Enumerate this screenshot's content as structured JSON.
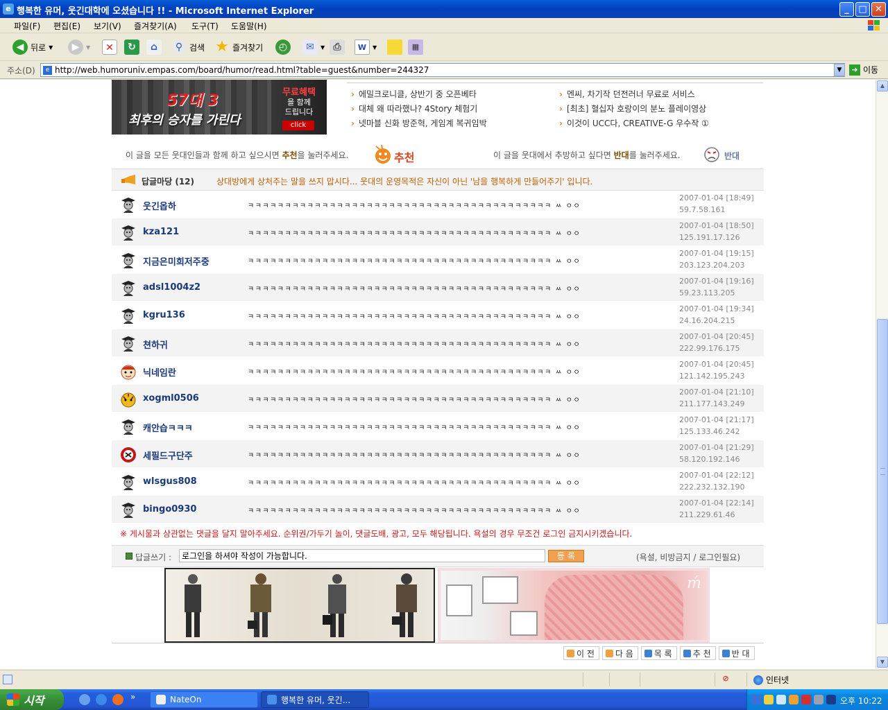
{
  "window": {
    "title": "행복한 유머, 웃긴대학에 오셨습니다 !! - Microsoft Internet Explorer",
    "controls": {
      "minimize": "_",
      "maximize": "□",
      "close": "✕"
    }
  },
  "menu": [
    "파일(F)",
    "편집(E)",
    "보기(V)",
    "즐겨찾기(A)",
    "도구(T)",
    "도움말(H)"
  ],
  "toolbar": {
    "back": "뒤로",
    "search": "검색",
    "favorites": "즐겨찾기"
  },
  "address": {
    "label": "주소(D)",
    "url": "http://web.humoruniv.empas.com/board/humor/read.html?table=guest&number=244327",
    "go": "이동"
  },
  "banner": {
    "big": "57대 3",
    "sub": "최후의 승자를 가린다",
    "free_top": "무료혜택",
    "free_mid": "을 함께",
    "free_bot": "드립니다",
    "click": "click"
  },
  "news": {
    "left": [
      "에밀크로니클, 상반기 중 오픈베타",
      "대체 왜 따라했나? 4Story 체험기",
      "넷마블 신화 방준혁, 게임계 복귀임박"
    ],
    "right": [
      "엔씨, 차기작 던전러너 무료로 서비스",
      "[최초] 혈십자 호랑이의 분노 플레이영상",
      "이것이 UCC다, CREATIVE-G 우수작 ①"
    ]
  },
  "recommend": {
    "left_pre": "이 글을 모든 웃대인들과 함께 하고 싶으시면 ",
    "left_bold": "추천",
    "left_post": "을 눌러주세요.",
    "left_icon_label": "추천",
    "right_pre": "이 글을 웃대에서 추방하고 싶다면 ",
    "right_bold": "반대",
    "right_post": "를 눌러주세요.",
    "right_icon_label": "반대"
  },
  "replies": {
    "title": "답글마당 (12)",
    "notice": "상대방에게 상처주는 말을 쓰지 맙시다... 웃대의 운영목적은 자신이 아닌 '남을 행복하게 만들어주기' 입니다.",
    "items": [
      {
        "nick": "웃긴옵하",
        "msg": "ㅋㅋㅋㅋㅋㅋㅋㅋㅋㅋㅋㅋㅋㅋㅋㅋㅋㅋㅋㅋㅋㅋㅋㅋㅋㅋㅋㅋㅋㅋㅋㅋㅋㅋㅋㅋㅋㅋㅋㅋㅋ ㅆ ㅇㅇ",
        "date": "2007-01-04 [18:49]",
        "ip": "59.7.58.161",
        "avatar": "grad"
      },
      {
        "nick": "kza121",
        "msg": "ㅋㅋㅋㅋㅋㅋㅋㅋㅋㅋㅋㅋㅋㅋㅋㅋㅋㅋㅋㅋㅋㅋㅋㅋㅋㅋㅋㅋㅋㅋㅋㅋㅋㅋㅋㅋㅋㅋㅋㅋㅋ ㅆ ㅇㅇ",
        "date": "2007-01-04 [18:50]",
        "ip": "125.191.17.126",
        "avatar": "grad"
      },
      {
        "nick": "지금은미희저주중",
        "msg": "ㅋㅋㅋㅋㅋㅋㅋㅋㅋㅋㅋㅋㅋㅋㅋㅋㅋㅋㅋㅋㅋㅋㅋㅋㅋㅋㅋㅋㅋㅋㅋㅋㅋㅋㅋㅋㅋㅋㅋㅋㅋ ㅆ ㅇㅇ",
        "date": "2007-01-04 [19:15]",
        "ip": "203.123.204.203",
        "avatar": "grad"
      },
      {
        "nick": "adsl1004z2",
        "msg": "ㅋㅋㅋㅋㅋㅋㅋㅋㅋㅋㅋㅋㅋㅋㅋㅋㅋㅋㅋㅋㅋㅋㅋㅋㅋㅋㅋㅋㅋㅋㅋㅋㅋㅋㅋㅋㅋㅋㅋㅋㅋ ㅆ ㅇㅇ",
        "date": "2007-01-04 [19:16]",
        "ip": "59.23.113.205",
        "avatar": "grad"
      },
      {
        "nick": "kgru136",
        "msg": "ㅋㅋㅋㅋㅋㅋㅋㅋㅋㅋㅋㅋㅋㅋㅋㅋㅋㅋㅋㅋㅋㅋㅋㅋㅋㅋㅋㅋㅋㅋㅋㅋㅋㅋㅋㅋㅋㅋㅋㅋㅋ ㅆ ㅇㅇ",
        "date": "2007-01-04 [19:34]",
        "ip": "24.16.204.215",
        "avatar": "grad"
      },
      {
        "nick": "쳔하귀",
        "msg": "ㅋㅋㅋㅋㅋㅋㅋㅋㅋㅋㅋㅋㅋㅋㅋㅋㅋㅋㅋㅋㅋㅋㅋㅋㅋㅋㅋㅋㅋㅋㅋㅋㅋㅋㅋㅋㅋㅋㅋㅋㅋ ㅆ ㅇㅇ",
        "date": "2007-01-04 [20:45]",
        "ip": "222.99.176.175",
        "avatar": "grad"
      },
      {
        "nick": "닉네임란",
        "msg": "ㅋㅋㅋㅋㅋㅋㅋㅋㅋㅋㅋㅋㅋㅋㅋㅋㅋㅋㅋㅋㅋㅋㅋㅋㅋㅋㅋㅋㅋㅋㅋㅋㅋㅋㅋㅋㅋㅋㅋㅋㅋ ㅆ ㅇㅇ",
        "date": "2007-01-04 [20:45]",
        "ip": "121.142.195.243",
        "avatar": "face"
      },
      {
        "nick": "xogml0506",
        "msg": "ㅋㅋㅋㅋㅋㅋㅋㅋㅋㅋㅋㅋㅋㅋㅋㅋㅋㅋㅋㅋㅋㅋㅋㅋㅋㅋㅋㅋㅋㅋㅋㅋㅋㅋㅋㅋㅋㅋㅋㅋㅋ ㅆ ㅇㅇ",
        "date": "2007-01-04 [21:10]",
        "ip": "211.177.143.249",
        "avatar": "tiger"
      },
      {
        "nick": "캐안습ㅋㅋㅋ",
        "msg": "ㅋㅋㅋㅋㅋㅋㅋㅋㅋㅋㅋㅋㅋㅋㅋㅋㅋㅋㅋㅋㅋㅋㅋㅋㅋㅋㅋㅋㅋㅋㅋㅋㅋㅋㅋㅋㅋㅋㅋㅋㅋ ㅆ ㅇㅇ",
        "date": "2007-01-04 [21:17]",
        "ip": "125.133.46.242",
        "avatar": "grad"
      },
      {
        "nick": "세필드구단주",
        "msg": "ㅋㅋㅋㅋㅋㅋㅋㅋㅋㅋㅋㅋㅋㅋㅋㅋㅋㅋㅋㅋㅋㅋㅋㅋㅋㅋㅋㅋㅋㅋㅋㅋㅋㅋㅋㅋㅋㅋㅋㅋㅋ ㅆ ㅇㅇ",
        "date": "2007-01-04 [21:29]",
        "ip": "58.120.192.146",
        "avatar": "crest"
      },
      {
        "nick": "wlsgus808",
        "msg": "ㅋㅋㅋㅋㅋㅋㅋㅋㅋㅋㅋㅋㅋㅋㅋㅋㅋㅋㅋㅋㅋㅋㅋㅋㅋㅋㅋㅋㅋㅋㅋㅋㅋㅋㅋㅋㅋㅋㅋㅋㅋ ㅆ ㅇㅇ",
        "date": "2007-01-04 [22:12]",
        "ip": "222.232.132.190",
        "avatar": "grad"
      },
      {
        "nick": "bingo0930",
        "msg": "ㅋㅋㅋㅋㅋㅋㅋㅋㅋㅋㅋㅋㅋㅋㅋㅋㅋㅋㅋㅋㅋㅋㅋㅋㅋㅋㅋㅋㅋㅋㅋㅋㅋㅋㅋㅋㅋㅋㅋㅋㅋ ㅆ ㅇㅇ",
        "date": "2007-01-04 [22:14]",
        "ip": "211.229.61.46",
        "avatar": "grad"
      }
    ]
  },
  "warning": "※ 게시물과 상관없는 댓글을 달지 말아주세요. 순위권/가두기 놀이, 댓글도배, 광고, 모두 해당됩니다. 욕설의 경우 무조건 로그인 금지시키겠습니다.",
  "write": {
    "label": "답글쓰기 :",
    "value": "로그인을 하셔야 작성이 가능합니다.",
    "submit": "등 록",
    "note": "(욕설, 비방금지 / 로그인필요)"
  },
  "nav": [
    {
      "label": "이 전",
      "color": "#f0a040"
    },
    {
      "label": "다 음",
      "color": "#f0a040"
    },
    {
      "label": "목 록",
      "color": "#4080d0"
    },
    {
      "label": "추 천",
      "color": "#4080d0"
    },
    {
      "label": "반 대",
      "color": "#4080d0"
    }
  ],
  "status": {
    "zone": "인터넷"
  },
  "taskbar": {
    "start": "시작",
    "tasks": [
      {
        "label": "NateOn"
      },
      {
        "label": "행복한 유머, 웃긴..."
      }
    ],
    "clock": "오후 10:22"
  }
}
